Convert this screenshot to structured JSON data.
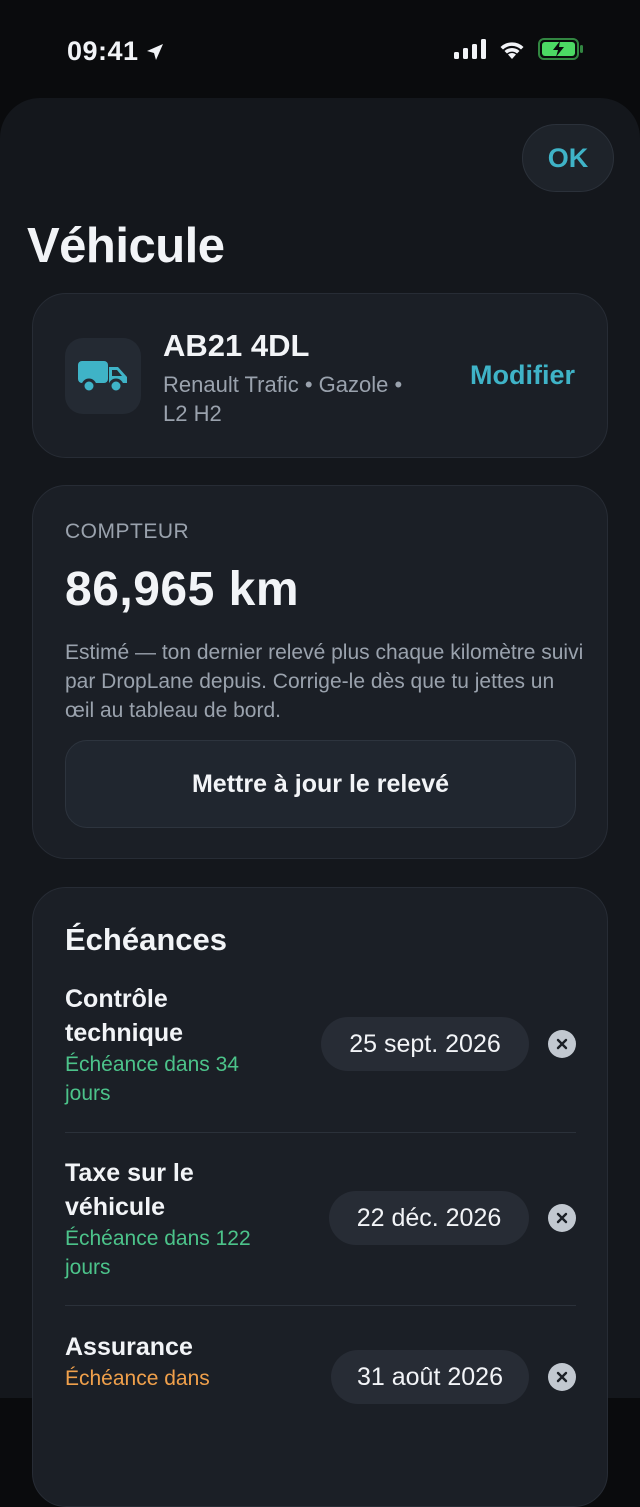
{
  "status_bar": {
    "time": "09:41",
    "location_icon": "location-arrow-icon",
    "signal_icon": "cellular-signal-icon",
    "wifi_icon": "wifi-icon",
    "battery_icon": "battery-charging-icon",
    "battery_color": "#4cd964"
  },
  "header": {
    "ok_label": "OK",
    "title": "Véhicule"
  },
  "vehicle": {
    "icon": "truck-icon",
    "plate": "AB21 4DL",
    "description": "Renault Trafic • Gazole • L2 H2",
    "modify_label": "Modifier"
  },
  "odometer": {
    "label": "COMPTEUR",
    "value": "86,965 km",
    "note": "Estimé — ton dernier relevé plus chaque kilomètre suivi par DropLane depuis. Corrige-le dès que tu jettes un œil au tableau de bord.",
    "update_label": "Mettre à jour le relevé"
  },
  "deadlines": {
    "title": "Échéances",
    "items": [
      {
        "name": "Contrôle technique",
        "status": "Échéance dans 34 jours",
        "date": "25 sept. 2026",
        "status_color": "#4cc38a"
      },
      {
        "name": "Taxe sur le véhicule",
        "status": "Échéance dans 122 jours",
        "date": "22 déc. 2026",
        "status_color": "#4cc38a"
      },
      {
        "name": "Assurance",
        "status": "Échéance dans",
        "date": "31 août 2026",
        "status_color": "#f0a04b"
      }
    ]
  },
  "colors": {
    "accent": "#3fb3c7",
    "background": "#0a0b0d",
    "sheet": "#14171c",
    "card": "#1b1f26"
  }
}
